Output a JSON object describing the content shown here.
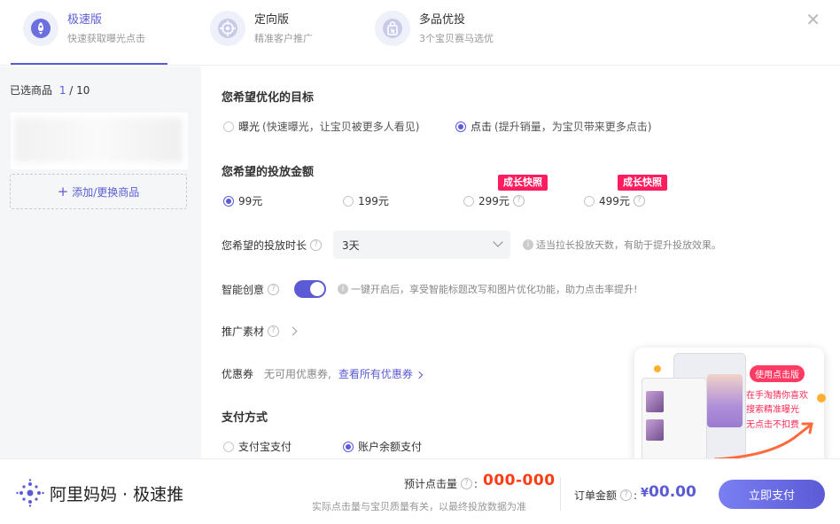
{
  "tabs": [
    {
      "title": "极速版",
      "subtitle": "快速获取曝光点击",
      "icon": "rocket-icon",
      "active": true
    },
    {
      "title": "定向版",
      "subtitle": "精准客户推广",
      "icon": "target-icon",
      "active": false
    },
    {
      "title": "多品优投",
      "subtitle": "3个宝贝赛马选优",
      "icon": "bag-icon",
      "active": false
    }
  ],
  "close_symbol": "✕",
  "left": {
    "selected_label": "已选商品",
    "selected_num": "1",
    "selected_total": " / 10",
    "add_button": "添加/更换商品",
    "add_plus": "+"
  },
  "goal": {
    "title": "您希望优化的目标",
    "options": [
      {
        "label": "曝光",
        "desc": "(快速曝光，让宝贝被更多人看见)",
        "selected": false
      },
      {
        "label": "点击",
        "desc": "(提升销量，为宝贝带来更多点击)",
        "selected": true
      }
    ]
  },
  "budget": {
    "title": "您希望的投放金额",
    "options": [
      {
        "label": "99元",
        "selected": true,
        "badge": ""
      },
      {
        "label": "199元",
        "selected": false,
        "badge": ""
      },
      {
        "label": "299元",
        "selected": false,
        "badge": "成长快照"
      },
      {
        "label": "499元",
        "selected": false,
        "badge": "成长快照"
      }
    ]
  },
  "duration": {
    "label": "您希望的投放时长",
    "value": "3天",
    "hint": "适当拉长投放天数，有助于提升投放效果。"
  },
  "smart": {
    "label": "智能创意",
    "enabled": true,
    "hint": "一键开启后，享受智能标题改写和图片优化功能，助力点击率提升!"
  },
  "material": {
    "label": "推广素材"
  },
  "coupon": {
    "label": "优惠券",
    "none_text": "无可用优惠券,",
    "link": "查看所有优惠券"
  },
  "payment": {
    "title": "支付方式",
    "options": [
      {
        "label": "支付宝支付",
        "selected": false
      },
      {
        "label": "账户余额支付",
        "selected": true
      }
    ]
  },
  "promo": {
    "tag": "使用点击版",
    "lines": [
      "在手淘猜你喜欢",
      "搜索精准曝光",
      "无点击不扣费"
    ]
  },
  "footer": {
    "brand": "阿里妈妈 · 极速推",
    "est_label": "预计点击量",
    "est_value": "000-000",
    "est_note": "实际点击量与宝贝质量有关，以最终投放数据为准",
    "order_label": "订单金额",
    "order_currency": "¥",
    "order_value": "00.00",
    "pay_button": "立即支付"
  },
  "colors": {
    "accent": "#5b5bd6",
    "badge": "#ff1d60",
    "estimate": "#ff3c14"
  },
  "help_symbol": "?",
  "colon": ":",
  "info_symbol": "i"
}
